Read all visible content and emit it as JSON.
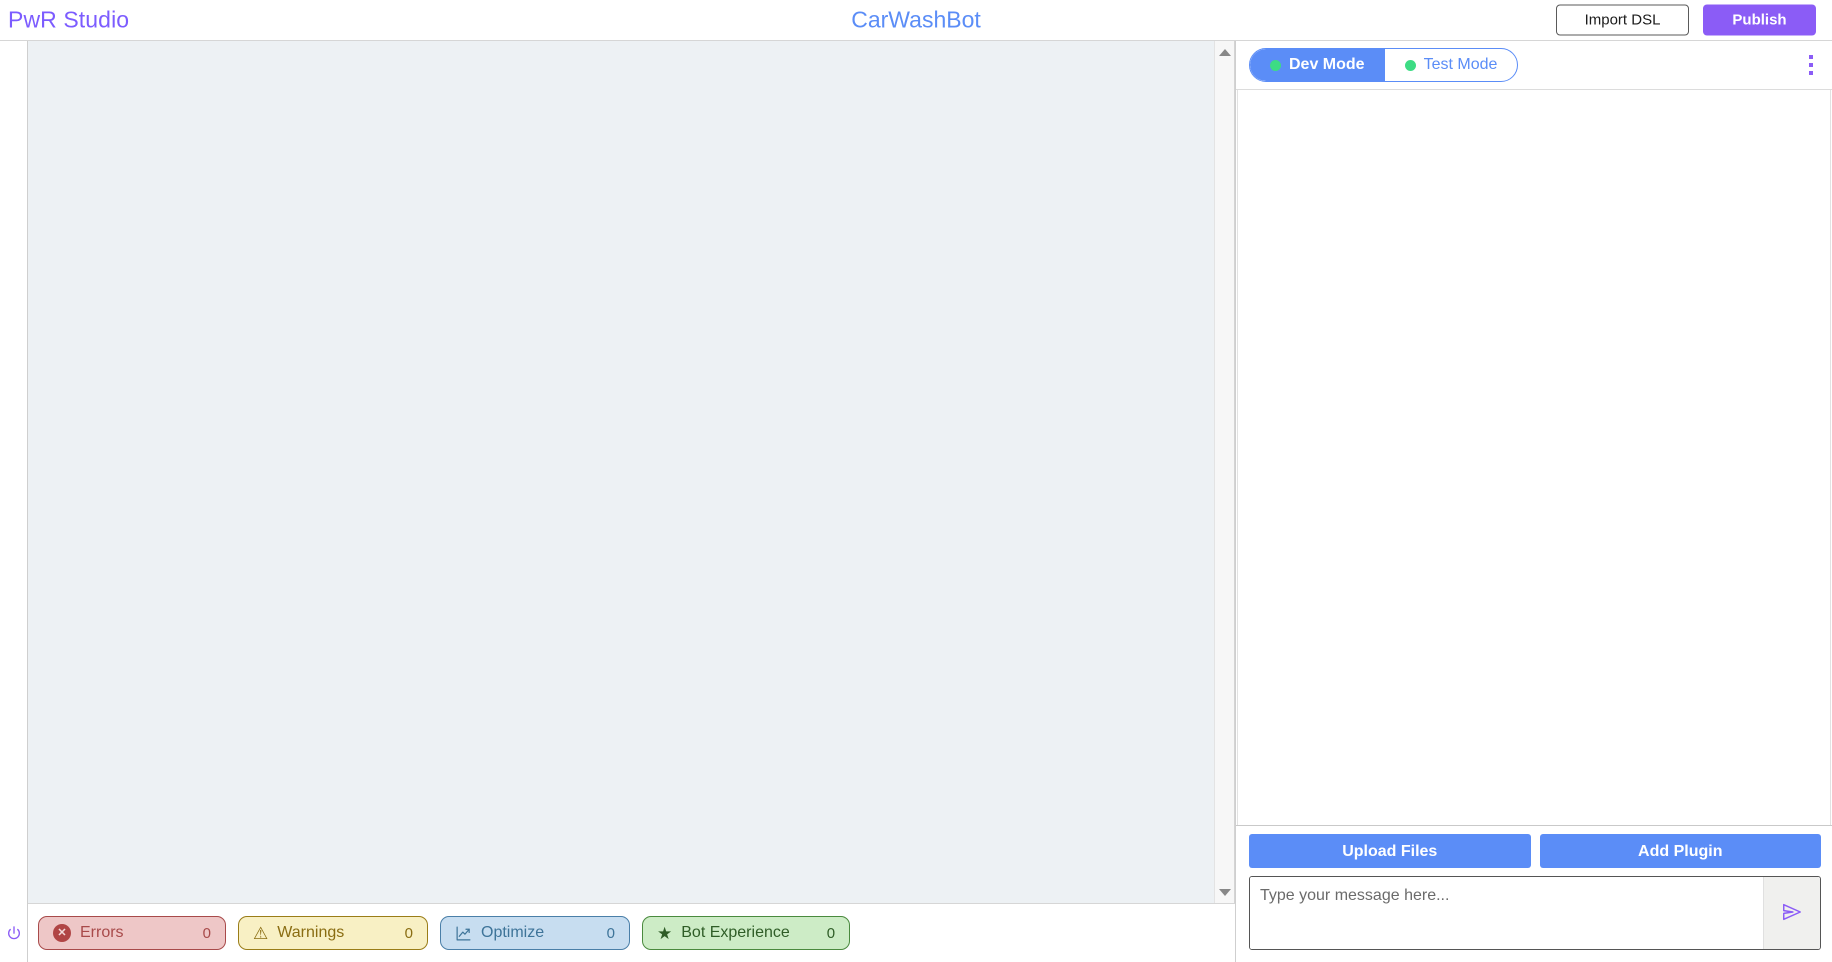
{
  "header": {
    "brand": "PwR Studio",
    "bot_title": "CarWashBot",
    "import_label": "Import DSL",
    "publish_label": "Publish",
    "brand_color": "#7c5cff",
    "title_color": "#5b8df7",
    "publish_bg": "#8b5cf6"
  },
  "left_rail": {
    "power_icon": "power-icon"
  },
  "canvas": {
    "background": "#edf1f4",
    "content": ""
  },
  "scrollbar": {
    "up_icon": "chevron-up-icon",
    "down_icon": "chevron-down-icon"
  },
  "status_bar": {
    "badges": [
      {
        "label": "Errors",
        "count": "0",
        "icon": "error-circle-icon",
        "bg": "#eec7c7",
        "border": "#a84a4a",
        "fg": "#a84a4a"
      },
      {
        "label": "Warnings",
        "count": "0",
        "icon": "warning-triangle-icon",
        "bg": "#f8f0c4",
        "border": "#9a7d18",
        "fg": "#8a6d12"
      },
      {
        "label": "Optimize",
        "count": "0",
        "icon": "trending-up-icon",
        "bg": "#c7ddf0",
        "border": "#4a7fa8",
        "fg": "#3e7499"
      },
      {
        "label": "Bot Experience",
        "count": "0",
        "icon": "star-icon",
        "bg": "#cdecc6",
        "border": "#4a8a3e",
        "fg": "#2f5d27"
      }
    ]
  },
  "right_panel": {
    "modes": [
      {
        "label": "Dev Mode",
        "active": true,
        "dot": "status-dot-green"
      },
      {
        "label": "Test Mode",
        "active": false,
        "dot": "status-dot-green"
      }
    ],
    "menu_icon": "kebab-menu-icon",
    "accent": "#5b8df7",
    "chat_messages": [],
    "upload_label": "Upload Files",
    "plugin_label": "Add Plugin",
    "input_placeholder": "Type your message here...",
    "input_value": "",
    "send_icon": "send-paper-plane-icon"
  }
}
